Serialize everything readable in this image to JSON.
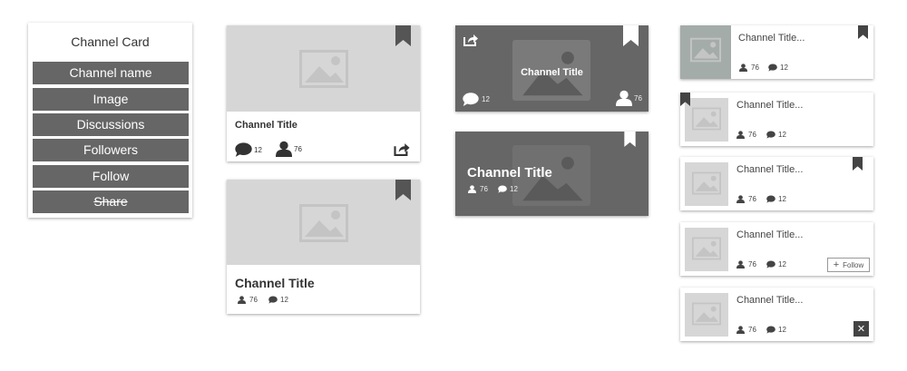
{
  "legend": {
    "title": "Channel Card",
    "items": [
      "Channel name",
      "Image",
      "Discussions",
      "Followers",
      "Follow",
      "Share"
    ]
  },
  "cards": {
    "card1": {
      "title": "Channel Title",
      "discussions": "12",
      "followers": "76"
    },
    "card2": {
      "title": "Channel Title",
      "followers": "76",
      "discussions": "12"
    },
    "card3": {
      "title": "Channel Title",
      "discussions": "12",
      "followers": "76"
    },
    "card4": {
      "title": "Channel Title",
      "followers": "76",
      "discussions": "12"
    }
  },
  "list": [
    {
      "title": "Channel Title...",
      "followers": "76",
      "discussions": "12"
    },
    {
      "title": "Channel Title...",
      "followers": "76",
      "discussions": "12"
    },
    {
      "title": "Channel Title...",
      "followers": "76",
      "discussions": "12"
    },
    {
      "title": "Channel Title...",
      "followers": "76",
      "discussions": "12",
      "follow_label": "Follow"
    },
    {
      "title": "Channel Title...",
      "followers": "76",
      "discussions": "12",
      "close_label": "✕"
    }
  ],
  "colors": {
    "dark_gray": "#666666",
    "placeholder": "#d6d6d6",
    "bookmark_dark": "#555555"
  }
}
